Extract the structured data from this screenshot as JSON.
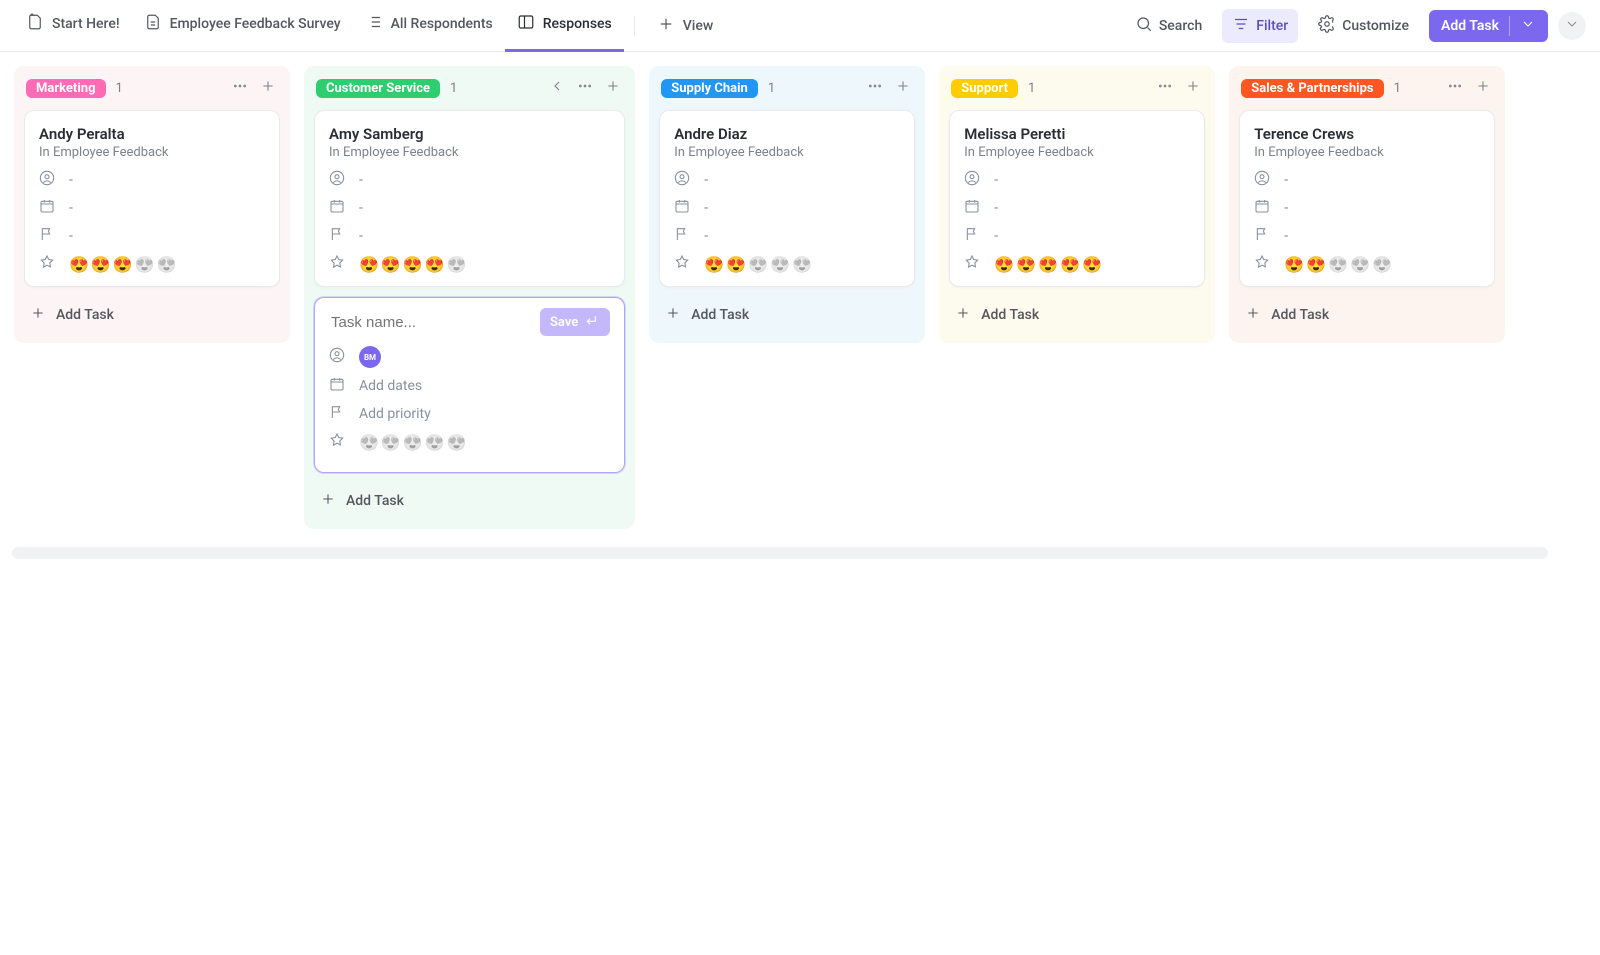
{
  "toolbar": {
    "tabs": {
      "start_here": "Start Here!",
      "employee_feedback": "Employee Feedback Survey",
      "all_respondents": "All Respondents",
      "responses": "Responses"
    },
    "plus_view_label": "View",
    "search_label": "Search",
    "filter_label": "Filter",
    "customize_label": "Customize",
    "add_task_button": "Add Task"
  },
  "columns": [
    {
      "id": "marketing",
      "title": "Marketing",
      "count": "1",
      "color_class": "pink",
      "bg_class": "col-bg-pink",
      "title_class": "title-pink",
      "show_collapse_arrow": false,
      "cards": [
        {
          "title": "Andy Peralta",
          "subtitle": "In Employee Feedback",
          "assignee": "-",
          "date": "-",
          "priority": "-",
          "rating_filled": 3,
          "rating_total": 5
        }
      ],
      "add_task_label": "Add Task"
    },
    {
      "id": "customer",
      "title": "Customer Service",
      "count": "1",
      "bg_class": "col-bg-green",
      "title_class": "title-green",
      "show_collapse_arrow": true,
      "cards": [
        {
          "title": "Amy Samberg",
          "subtitle": "In Employee Feedback",
          "assignee": "-",
          "date": "-",
          "priority": "-",
          "rating_filled": 4,
          "rating_total": 5
        }
      ],
      "new_card": {
        "placeholder": "Task name...",
        "save_label": "Save",
        "assignee_initials": "BM",
        "dates_label": "Add dates",
        "priority_label": "Add priority",
        "rating_filled": 0,
        "rating_total": 5
      },
      "add_task_label": "Add Task"
    },
    {
      "id": "supply",
      "title": "Supply Chain",
      "count": "1",
      "bg_class": "col-bg-blue",
      "title_class": "title-blue",
      "show_collapse_arrow": false,
      "cards": [
        {
          "title": "Andre Diaz",
          "subtitle": "In Employee Feedback",
          "assignee": "-",
          "date": "-",
          "priority": "-",
          "rating_filled": 2,
          "rating_total": 5
        }
      ],
      "add_task_label": "Add Task"
    },
    {
      "id": "support",
      "title": "Support",
      "count": "1",
      "bg_class": "col-bg-yellow",
      "title_class": "title-yellow",
      "show_collapse_arrow": false,
      "cards": [
        {
          "title": "Melissa Peretti",
          "subtitle": "In Employee Feedback",
          "assignee": "-",
          "date": "-",
          "priority": "-",
          "rating_filled": 5,
          "rating_total": 5
        }
      ],
      "add_task_label": "Add Task"
    },
    {
      "id": "sales",
      "title": "Sales & Partnerships",
      "count": "1",
      "bg_class": "col-bg-orange",
      "title_class": "title-orange",
      "show_collapse_arrow": false,
      "cards": [
        {
          "title": "Terence Crews",
          "subtitle": "In Employee Feedback",
          "assignee": "-",
          "date": "-",
          "priority": "-",
          "rating_filled": 2,
          "rating_total": 5
        }
      ],
      "add_task_label": "Add Task"
    }
  ]
}
